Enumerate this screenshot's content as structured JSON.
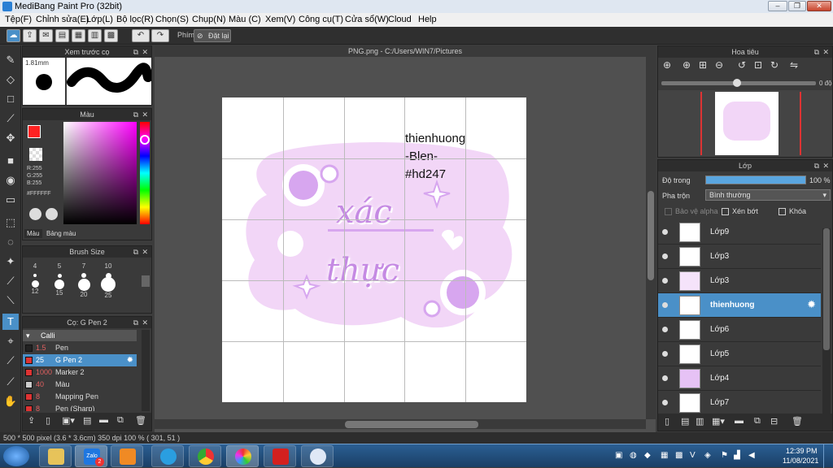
{
  "window": {
    "title": "MediBang Paint Pro (32bit)"
  },
  "menu": [
    "Tệp(F)",
    "Chỉnh sửa(E)",
    "Lớp(L)",
    "Bộ lọc(R)",
    "Chọn(S)",
    "Chụp(N)",
    "Màu (C)",
    "Xem(V)",
    "Công cụ(T)",
    "Cửa sổ(W)",
    "Cloud",
    "Help"
  ],
  "toolbar": {
    "snap_label": "Phím",
    "reset_label": "Đặt lại"
  },
  "brush_preview": {
    "title": "Xem trước cọ",
    "size": "1.81mm"
  },
  "color_panel": {
    "title": "Màu",
    "r": "R:255",
    "g": "G:255",
    "b": "B:255",
    "hex": "#FFFFFF",
    "tab_color": "Màu",
    "tab_palette": "Bảng màu",
    "foreground": "#ff2222",
    "background": "#ffffff"
  },
  "brush_size": {
    "title": "Brush Size",
    "sizes": [
      "4",
      "5",
      "7",
      "10",
      "12",
      "15",
      "20",
      "25"
    ]
  },
  "brush_list": {
    "title": "Cọ: G Pen 2",
    "group": "Calli",
    "items": [
      {
        "size": "1.5",
        "name": "Pen",
        "color": "#222222"
      },
      {
        "size": "25",
        "name": "G Pen 2",
        "color": "#dd3333"
      },
      {
        "size": "1000",
        "name": "Marker 2",
        "color": "#dd3333"
      },
      {
        "size": "40",
        "name": "Màu",
        "color": "#cccccc"
      },
      {
        "size": "8",
        "name": "Mapping Pen",
        "color": "#dd3333"
      },
      {
        "size": "8",
        "name": "Pen (Sharp)",
        "color": "#dd3333"
      }
    ]
  },
  "document": {
    "tab": "PNG.png - C:/Users/WIN7/Pictures",
    "text_lines": [
      "thienhuong",
      "-Blen-",
      "#hd247"
    ],
    "art_word1": "xác",
    "art_word2": "thực"
  },
  "navigator": {
    "title": "Hoa tiêu",
    "angle": "0 độ"
  },
  "layers_panel": {
    "title": "Lớp",
    "opacity_label": "Độ trong",
    "opacity_value": "100 %",
    "opacity": 1.0,
    "blend_label": "Pha trộn",
    "blend_value": "Bình thường",
    "protect_alpha": "Bảo vệ alpha",
    "clipping": "Xén bớt",
    "lock": "Khóa",
    "layers": [
      {
        "name": "Lớp9",
        "selected": false
      },
      {
        "name": "Lớp3",
        "selected": false
      },
      {
        "name": "Lớp3",
        "selected": false
      },
      {
        "name": "thienhuong",
        "selected": true
      },
      {
        "name": "Lớp6",
        "selected": false
      },
      {
        "name": "Lớp5",
        "selected": false
      },
      {
        "name": "Lớp4",
        "selected": false
      },
      {
        "name": "Lớp7",
        "selected": false
      }
    ]
  },
  "statusbar": {
    "info": "500 * 500 pixel   (3.6 * 3.6cm)   350 dpi   100 %   ( 301, 51 )"
  },
  "taskbar": {
    "time": "12:39 PM",
    "date": "11/08/2021",
    "zalo_label": "Zalo",
    "zalo_badge": "2"
  },
  "icons": [
    "brush-icon",
    "eraser-icon",
    "rectangle-icon",
    "pen-icon",
    "move-icon",
    "fill-icon",
    "bucket-icon",
    "gradient-icon",
    "select-icon",
    "lasso-icon",
    "magic-wand-icon",
    "text-icon",
    "hand-icon",
    "eyedropper-icon",
    "undo-icon",
    "redo-icon",
    "zoom-icon",
    "eye-icon",
    "gear-icon"
  ],
  "accent": "#4a90c8"
}
